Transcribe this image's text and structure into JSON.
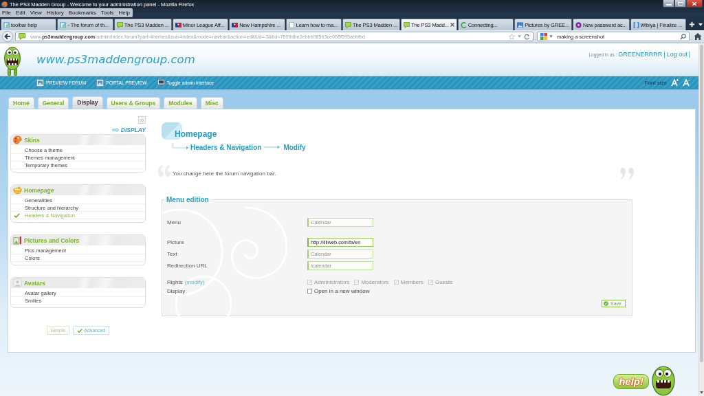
{
  "window": {
    "title": "The PS3 Madden Group - Welcome to your administration panel - Mozilla Firefox"
  },
  "menu_bar": [
    "File",
    "Edit",
    "View",
    "History",
    "Bookmarks",
    "Tools",
    "Help"
  ],
  "browser_tabs": [
    {
      "label": "toolbar help",
      "selected": false
    },
    {
      "label": "- The forum of th...",
      "selected": false
    },
    {
      "label": "The PS3 Madden ...",
      "selected": false
    },
    {
      "label": "Minor League Aff...",
      "selected": false
    },
    {
      "label": "New Hampshire ...",
      "selected": false
    },
    {
      "label": "Learn how to ma...",
      "selected": false
    },
    {
      "label": "The PS3 Madden ...",
      "selected": false
    },
    {
      "label": "The PS3 Madd...",
      "selected": true
    },
    {
      "label": "Connecting...",
      "selected": false
    },
    {
      "label": "Pictures by GREE...",
      "selected": false
    },
    {
      "label": "New password ac...",
      "selected": false
    },
    {
      "label": "Wibiya | Finalize ...",
      "selected": false
    }
  ],
  "address_bar": {
    "url": "www.**ps3maddengroup.com**/admin/index.forum?part=themes&sub=index&mode=navbar&action=edit&id=-3&tid=7609dbe2ebbb085b3ce008f595abbfbd"
  },
  "search": {
    "value": "making a screenshot"
  },
  "site": {
    "name": "www.ps3maddengroup.com",
    "login": {
      "label": "Logged in as :",
      "username": "GREENERRRR",
      "separator": "|",
      "logout": "Log out",
      "end": "|"
    }
  },
  "toolbar": {
    "links": [
      "PREVIEW FORUM",
      "PORTAL PREVIEW",
      "Toggle admin interface"
    ],
    "font_size": "Font size"
  },
  "admin_tabs": [
    {
      "label": "Home",
      "selected": false
    },
    {
      "label": "General",
      "selected": false
    },
    {
      "label": "Display",
      "selected": true
    },
    {
      "label": "Users & Groups",
      "selected": false
    },
    {
      "label": "Modules",
      "selected": false
    },
    {
      "label": "Misc",
      "selected": false
    }
  ],
  "sidebar": {
    "section_title": "DISPLAY",
    "groups": [
      {
        "title": "Skins",
        "items": [
          {
            "label": "Choose a theme",
            "selected": false
          },
          {
            "label": "Themes management",
            "selected": false
          },
          {
            "label": "Temporary themes",
            "selected": false
          }
        ]
      },
      {
        "title": "Homepage",
        "items": [
          {
            "label": "Generalities",
            "selected": false
          },
          {
            "label": "Structure and hierarchy",
            "selected": false
          },
          {
            "label": "Headers & Navigation",
            "selected": true
          }
        ]
      },
      {
        "title": "Pictures and Colors",
        "items": [
          {
            "label": "Pics management",
            "selected": false
          },
          {
            "label": "Colors",
            "selected": false
          }
        ]
      },
      {
        "title": "Avatars",
        "items": [
          {
            "label": "Avatar gallery",
            "selected": false
          },
          {
            "label": "Smilies",
            "selected": false
          }
        ]
      }
    ],
    "modes": [
      {
        "label": "Simple",
        "selected": false
      },
      {
        "label": "Advanced",
        "selected": true
      }
    ]
  },
  "content": {
    "title": "Homepage",
    "breadcrumb": [
      "Headers & Navigation",
      "Modify"
    ],
    "description": "You change here the forum navigation bar.",
    "form": {
      "legend": "Menu edition",
      "fields": [
        {
          "label": "Menu",
          "value": "Calendar",
          "disabled": true
        },
        {
          "label": "Picture",
          "value": "http://illiweb.com/fa/en",
          "disabled": false
        },
        {
          "label": "Text",
          "value": "Calendar",
          "disabled": true
        },
        {
          "label": "Redirection URL",
          "value": "/calendar",
          "disabled": true
        }
      ],
      "rights": {
        "label": "Rights",
        "link": "(modify)",
        "options": [
          {
            "label": "Administrators",
            "checked": true,
            "disabled": true
          },
          {
            "label": "Moderators",
            "checked": true,
            "disabled": true
          },
          {
            "label": "Members",
            "checked": true,
            "disabled": true
          },
          {
            "label": "Guests",
            "checked": true,
            "disabled": true
          }
        ]
      },
      "display": {
        "label": "Display",
        "option": {
          "label": "Open in a new window",
          "checked": false
        }
      },
      "save": "Save"
    }
  },
  "help": {
    "label": "help!"
  }
}
